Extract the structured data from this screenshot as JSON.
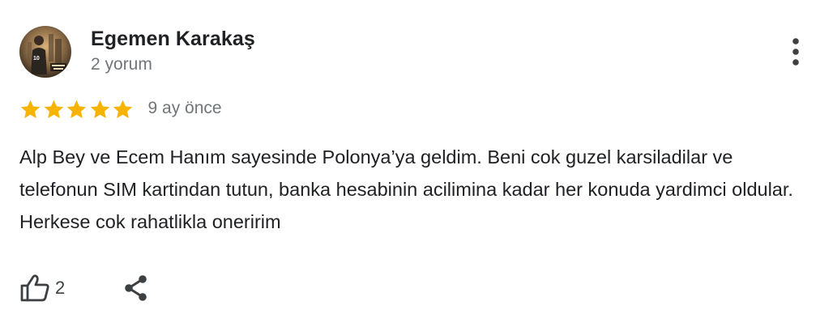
{
  "review": {
    "author": {
      "name": "Egemen Karakaş",
      "review_count": "2 yorum",
      "avatar_icon": "profile-photo"
    },
    "rating": {
      "stars": 5,
      "max_stars": 5,
      "star_color": "#f6b400",
      "date": "9 ay önce"
    },
    "text": "Alp Bey ve Ecem Hanım sayesinde Polonya’ya geldim. Beni cok guzel karsiladilar ve telefonun SIM kartindan tutun, banka hesabinin acilimina kadar her konuda yardimci oldular. Herkese cok rahatlikla oneririm",
    "actions": {
      "like_icon": "thumbs-up-icon",
      "like_count": "2",
      "share_icon": "share-icon",
      "more_icon": "more-vert-icon"
    }
  }
}
